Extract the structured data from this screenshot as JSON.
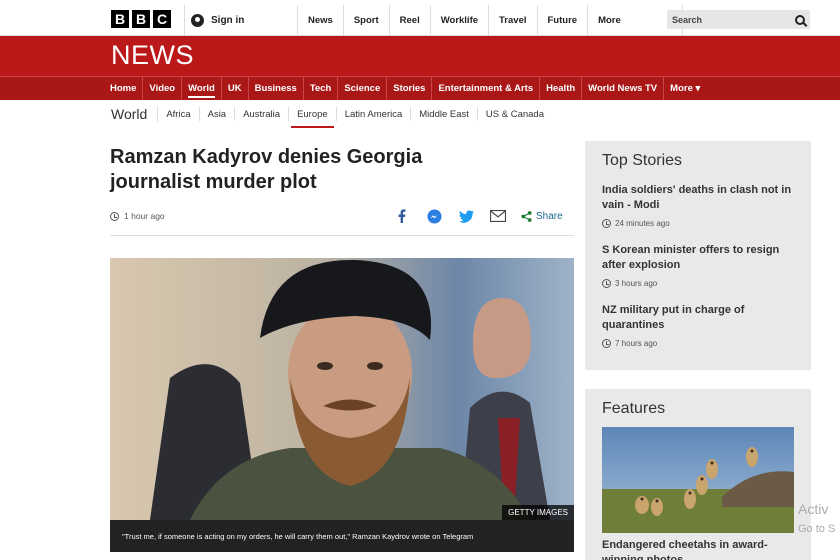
{
  "header": {
    "logo_letters": [
      "B",
      "B",
      "C"
    ],
    "signin_label": "Sign in",
    "nav": [
      "News",
      "Sport",
      "Reel",
      "Worklife",
      "Travel",
      "Future",
      "More"
    ],
    "search_placeholder": "Search"
  },
  "banner": {
    "title": "NEWS"
  },
  "main_nav": [
    "Home",
    "Video",
    "World",
    "UK",
    "Business",
    "Tech",
    "Science",
    "Stories",
    "Entertainment & Arts",
    "Health",
    "World News TV",
    "More ▾"
  ],
  "main_nav_active": "World",
  "sub_nav": {
    "title": "World",
    "items": [
      "Africa",
      "Asia",
      "Australia",
      "Europe",
      "Latin America",
      "Middle East",
      "US & Canada"
    ],
    "active": "Europe"
  },
  "article": {
    "headline": "Ramzan Kadyrov denies Georgia journalist murder plot",
    "time": "1 hour ago",
    "share_label": "Share",
    "image_credit": "GETTY IMAGES",
    "caption": "\"Trust me, if someone is acting on my orders, he will carry them out,\" Ramzan Kaydrov wrote on Telegram"
  },
  "sidebar": {
    "top_stories_title": "Top Stories",
    "stories": [
      {
        "title": "India soldiers' deaths in clash not in vain - Modi",
        "time": "24 minutes ago"
      },
      {
        "title": "S Korean minister offers to resign after explosion",
        "time": "3 hours ago"
      },
      {
        "title": "NZ military put in charge of quarantines",
        "time": "7 hours ago"
      }
    ],
    "features_title": "Features",
    "feature_title": "Endangered cheetahs in award-winning photos"
  },
  "watermark": {
    "line1": "Activ",
    "line2": "Go to S"
  },
  "colors": {
    "brand_red": "#bb1919",
    "nav_red": "#a91717",
    "share_blue": "#1d6a8a"
  }
}
